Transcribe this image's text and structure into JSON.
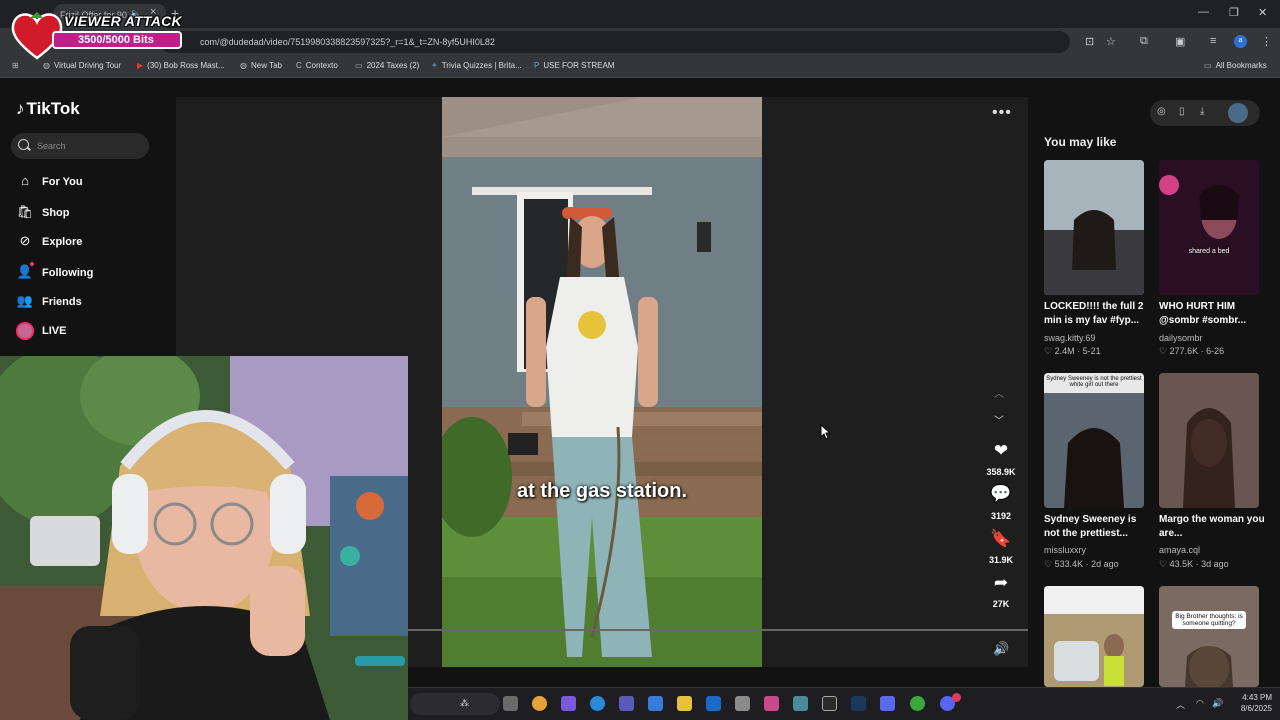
{
  "browser": {
    "tab_title": "Frizil Offer for 90",
    "address": "com/@dudedad/video/7519980338823597325?_r=1&_t=ZN-8yf5UHI0L82",
    "bookmarks": [
      "Virtual Driving Tour",
      "(30) Bob Ross Mast...",
      "New Tab",
      "Contexto",
      "2024 Taxes (2)",
      "Trivia Quizzes | Brita...",
      "USE FOR STREAM"
    ],
    "all_bookmarks": "All Bookmarks"
  },
  "overlay": {
    "title": "VIEWER ATTACK",
    "bits": "3500/5000 Bits"
  },
  "sidebar": {
    "logo": "TikTok",
    "search_placeholder": "Search",
    "items": [
      {
        "label": "For You",
        "icon": "home-icon"
      },
      {
        "label": "Shop",
        "icon": "shop-icon"
      },
      {
        "label": "Explore",
        "icon": "compass-icon"
      },
      {
        "label": "Following",
        "icon": "following-icon"
      },
      {
        "label": "Friends",
        "icon": "friends-icon"
      },
      {
        "label": "LIVE",
        "icon": "live-avatar"
      }
    ]
  },
  "video": {
    "caption": "at the gas station.",
    "likes": "358.9K",
    "comments": "3192",
    "saves": "31.9K",
    "shares": "27K"
  },
  "right_panel": {
    "heading": "You may like",
    "cards": [
      {
        "title": "LOCKED!!!! the full 2 min is my fav #fyp...",
        "author": "swag.kitty.69",
        "views": "2.4M",
        "date": "5-21",
        "thumb_color": "#8a9aa6"
      },
      {
        "title": "WHO HURT HIM @sombr #sombr...",
        "author": "dailysombr",
        "views": "277.6K",
        "date": "6-26",
        "thumb_color": "#3a1030",
        "thumb_text": "shared a bed"
      },
      {
        "title": "Sydney Sweeney is not the prettiest...",
        "author": "missluxxry",
        "views": "533.4K",
        "date": "2d ago",
        "thumb_color": "#4a5560",
        "thumb_text": "Sydney Sweeney is not the prettiest white girl out there"
      },
      {
        "title": "Margo the woman you are...",
        "author": "amaya.cql",
        "views": "43.5K",
        "date": "3d ago",
        "thumb_color": "#5a4a44"
      },
      {
        "title": "",
        "author": "",
        "views": "",
        "date": "",
        "thumb_color": "#9a8a6a"
      },
      {
        "title": "",
        "author": "",
        "views": "",
        "date": "",
        "thumb_color": "#6a5a52",
        "thumb_text": "Big Brother thoughts: is someone quitting?"
      }
    ]
  },
  "taskbar": {
    "time": "4:43 PM",
    "date": "8/6/2025"
  }
}
